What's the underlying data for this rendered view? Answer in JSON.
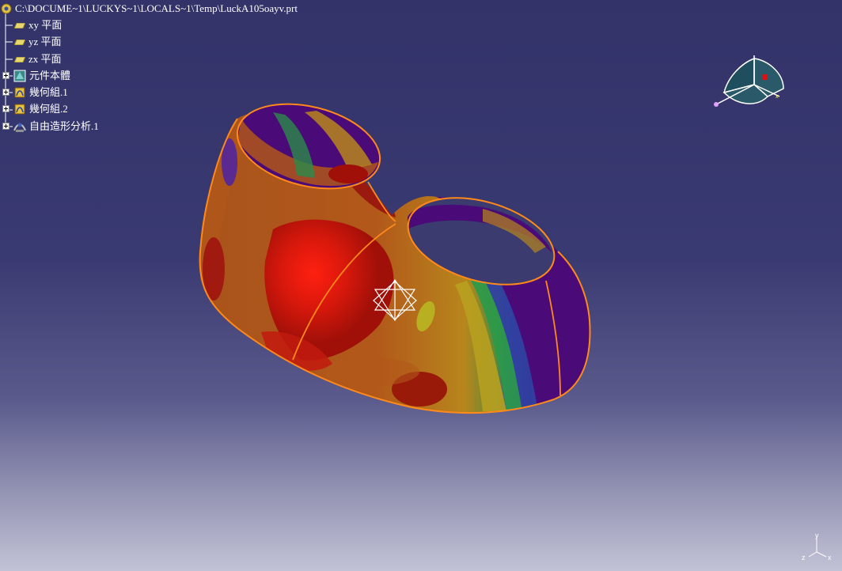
{
  "window": {
    "viewport": "3d-geometry-viewport",
    "background_top": "#33336a",
    "background_bottom": "#c2c2d6"
  },
  "tree": {
    "root": {
      "label": "C:\\DOCUME~1\\LUCKYS~1\\LOCALS~1\\Temp\\LuckA105oayv.prt",
      "icon": "part-file-icon"
    },
    "planes": [
      {
        "label": "xy 平面",
        "icon": "plane-icon"
      },
      {
        "label": "yz 平面",
        "icon": "plane-icon"
      },
      {
        "label": "zx 平面",
        "icon": "plane-icon"
      }
    ],
    "nodes": [
      {
        "label": "元件本體",
        "icon": "part-body-icon"
      },
      {
        "label": "幾何組.1",
        "icon": "geometrical-set-icon"
      },
      {
        "label": "幾何組.2",
        "icon": "geometrical-set-icon"
      },
      {
        "label": "自由造形分析.1",
        "icon": "freestyle-analysis-icon"
      }
    ],
    "text_color": "#ffffff"
  },
  "axis_indicator": {
    "labels": [
      "y",
      "z",
      "x"
    ]
  },
  "model": {
    "edge_color": "#ff8a1a",
    "colors": {
      "high": "#e01010",
      "mid": "#b0561a",
      "yellow": "#b8b020",
      "green": "#2a9a4a",
      "blue": "#3040a0",
      "low": "#4a0a78"
    }
  }
}
